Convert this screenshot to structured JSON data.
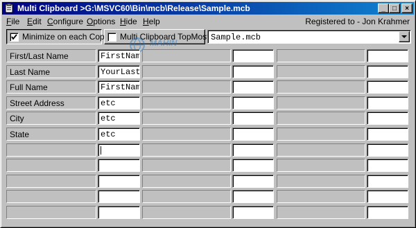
{
  "window": {
    "title": "Multi Clipboard >G:\\MSVC60\\Bin\\mcb\\Release\\Sample.mcb",
    "buttons": {
      "minimize": "_",
      "maximize": "□",
      "close": "×"
    }
  },
  "menu": {
    "items": [
      {
        "label": "File",
        "underline": "F",
        "rest": "ile"
      },
      {
        "label": "Edit",
        "underline": "E",
        "rest": "dit"
      },
      {
        "label": "Configure",
        "underline": "C",
        "rest": "onfigure"
      },
      {
        "label": "Options",
        "underline": "O",
        "rest": "ptions"
      },
      {
        "label": "Hide",
        "underline": "H",
        "rest": "ide"
      },
      {
        "label": "Help",
        "underline": "H",
        "rest": "elp"
      }
    ],
    "registered": "Registered to - Jon Krahmer"
  },
  "toolbar": {
    "minimize_copy": {
      "label": "Minimize on each Copy",
      "checked": true
    },
    "topmost": {
      "label": "Multi Clipboard TopMost",
      "checked": false
    },
    "file_combo": {
      "value": "Sample.mcb"
    }
  },
  "watermark": {
    "text": "MAHIN"
  },
  "grid": {
    "rows": [
      {
        "label": "First/Last Name",
        "value": "FirstNam"
      },
      {
        "label": "Last Name",
        "value": "YourLast"
      },
      {
        "label": "Full Name",
        "value": "FirstNam"
      },
      {
        "label": "Street Address",
        "value": "etc"
      },
      {
        "label": "City",
        "value": "etc"
      },
      {
        "label": "State",
        "value": "etc"
      },
      {
        "label": "",
        "value": ""
      },
      {
        "label": "",
        "value": ""
      },
      {
        "label": "",
        "value": ""
      },
      {
        "label": "",
        "value": ""
      },
      {
        "label": "",
        "value": ""
      }
    ]
  }
}
